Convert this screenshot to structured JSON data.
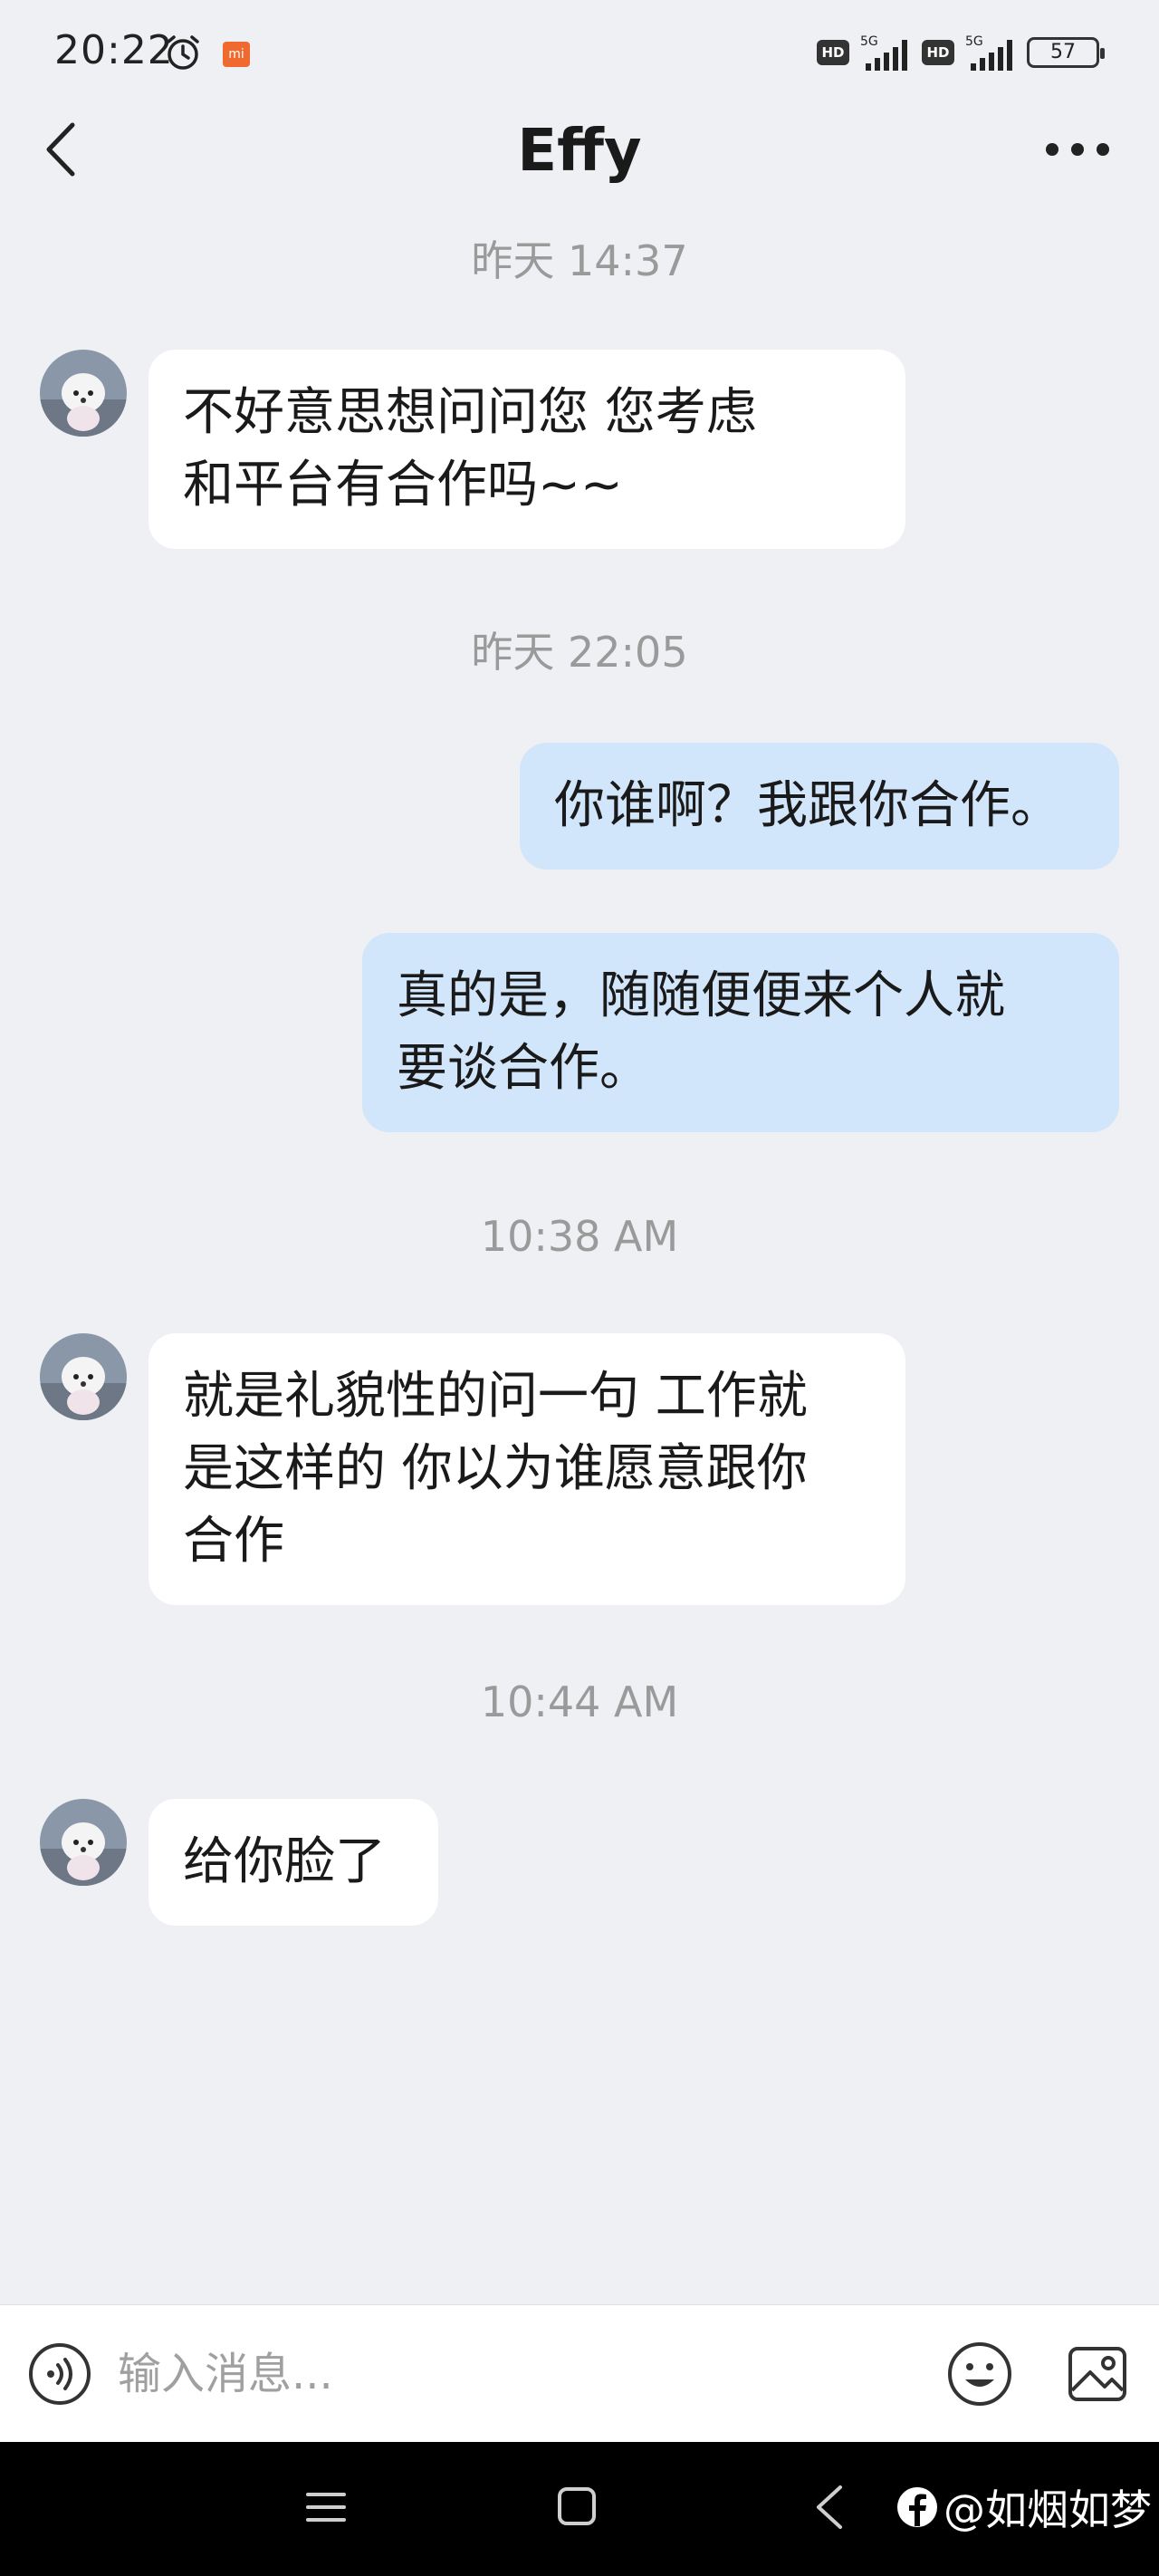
{
  "status_bar": {
    "time": "20:22",
    "network_1": "HD",
    "network_2": "HD",
    "signal_label": "5G",
    "battery": "57"
  },
  "header": {
    "title": "Effy"
  },
  "messages": [
    {
      "type": "timestamp",
      "text": "昨天 14:37"
    },
    {
      "type": "incoming",
      "lines": [
        "不好意思想问问您  您考虑",
        "和平台有合作吗~~"
      ]
    },
    {
      "type": "timestamp",
      "text": "昨天 22:05"
    },
    {
      "type": "outgoing",
      "lines": [
        "你谁啊？我跟你合作。"
      ]
    },
    {
      "type": "outgoing",
      "lines": [
        "真的是，随随便便来个人就",
        "要谈合作。"
      ]
    },
    {
      "type": "timestamp",
      "text": "10:38 AM"
    },
    {
      "type": "incoming",
      "lines": [
        "就是礼貌性的问一句 工作就",
        "是这样的 你以为谁愿意跟你",
        "合作"
      ]
    },
    {
      "type": "timestamp",
      "text": "10:44 AM"
    },
    {
      "type": "incoming",
      "lines": [
        "给你脸了"
      ]
    }
  ],
  "input": {
    "placeholder": "输入消息..."
  },
  "watermark": {
    "text": "@如烟如梦"
  },
  "colors": {
    "background": "#eef0f3",
    "incoming_bubble": "#ffffff",
    "outgoing_bubble": "#d2e6fb"
  },
  "icons": {
    "back": "chevron-left-icon",
    "more": "more-dots-icon",
    "voice": "voice-icon",
    "emoji": "emoji-icon",
    "image": "image-icon"
  }
}
